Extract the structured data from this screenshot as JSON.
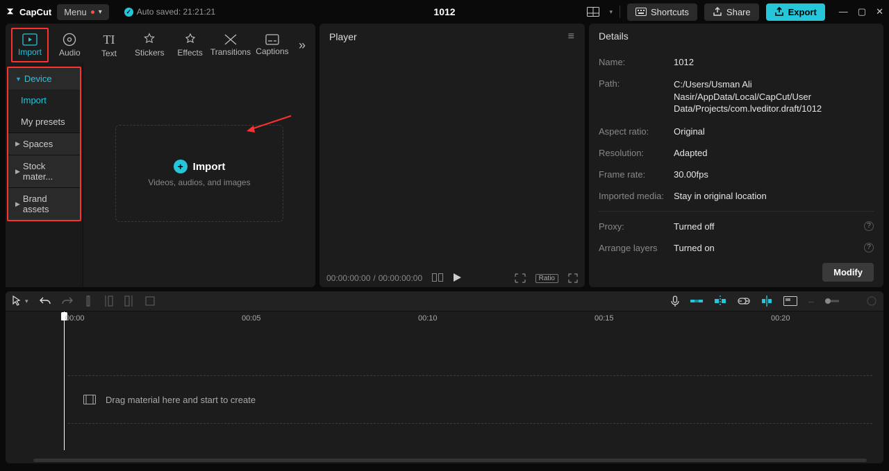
{
  "app": {
    "name": "CapCut"
  },
  "topbar": {
    "menu_label": "Menu",
    "autosave_label": "Auto saved: 21:21:21",
    "project_title": "1012",
    "shortcuts_label": "Shortcuts",
    "share_label": "Share",
    "export_label": "Export"
  },
  "tabs": {
    "import": "Import",
    "audio": "Audio",
    "text": "Text",
    "stickers": "Stickers",
    "effects": "Effects",
    "transitions": "Transitions",
    "captions": "Captions"
  },
  "sidebar": {
    "device": "Device",
    "import": "Import",
    "my_presets": "My presets",
    "spaces": "Spaces",
    "stock": "Stock mater...",
    "brand": "Brand assets"
  },
  "import_area": {
    "button_label": "Import",
    "subtext": "Videos, audios, and images"
  },
  "player": {
    "title": "Player",
    "time_current": "00:00:00:00",
    "time_total": "00:00:00:00",
    "ratio_badge": "Ratio"
  },
  "details": {
    "title": "Details",
    "name_label": "Name:",
    "name_value": "1012",
    "path_label": "Path:",
    "path_value": "C:/Users/Usman Ali Nasir/AppData/Local/CapCut/User Data/Projects/com.lveditor.draft/1012",
    "aspect_label": "Aspect ratio:",
    "aspect_value": "Original",
    "resolution_label": "Resolution:",
    "resolution_value": "Adapted",
    "framerate_label": "Frame rate:",
    "framerate_value": "30.00fps",
    "media_label": "Imported media:",
    "media_value": "Stay in original location",
    "proxy_label": "Proxy:",
    "proxy_value": "Turned off",
    "layers_label": "Arrange layers",
    "layers_value": "Turned on",
    "modify_label": "Modify"
  },
  "timeline": {
    "ticks": [
      "00:00",
      "00:05",
      "00:10",
      "00:15",
      "00:20"
    ],
    "drop_hint": "Drag material here and start to create"
  }
}
